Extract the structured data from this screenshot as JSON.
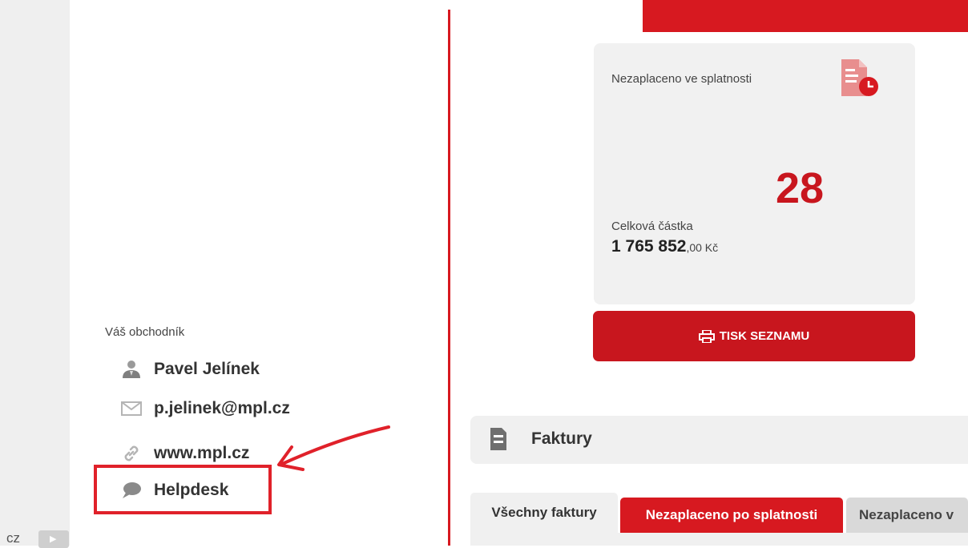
{
  "sidebar_strip": {
    "cut_text": "cz",
    "button_icon": "play-icon"
  },
  "sales_rep": {
    "title": "Váš obchodník",
    "name": "Pavel Jelínek",
    "email": "p.jelinek@mpl.cz",
    "website": "www.mpl.cz",
    "helpdesk": "Helpdesk",
    "icons": [
      "person-icon",
      "envelope-icon",
      "link-icon",
      "chat-bubble-icon"
    ]
  },
  "summary_card": {
    "title": "Nezaplaceno ve splatnosti",
    "icon": "invoice-clock-icon",
    "count": "28",
    "total_label": "Celková částka",
    "total_value": "1 765 852",
    "total_decimals": ",00 Kč"
  },
  "print_button": {
    "label": "TISK SEZNAMU",
    "icon": "printer-icon"
  },
  "invoices_section": {
    "title": "Faktury",
    "icon": "document-icon"
  },
  "tabs": [
    {
      "label": "Všechny faktury"
    },
    {
      "label": "Nezaplaceno po splatnosti"
    },
    {
      "label": "Nezaplaceno v"
    }
  ],
  "colors": {
    "accent_red": "#d71920",
    "dark_red": "#c8161e",
    "annotation_red": "#e0212a"
  }
}
